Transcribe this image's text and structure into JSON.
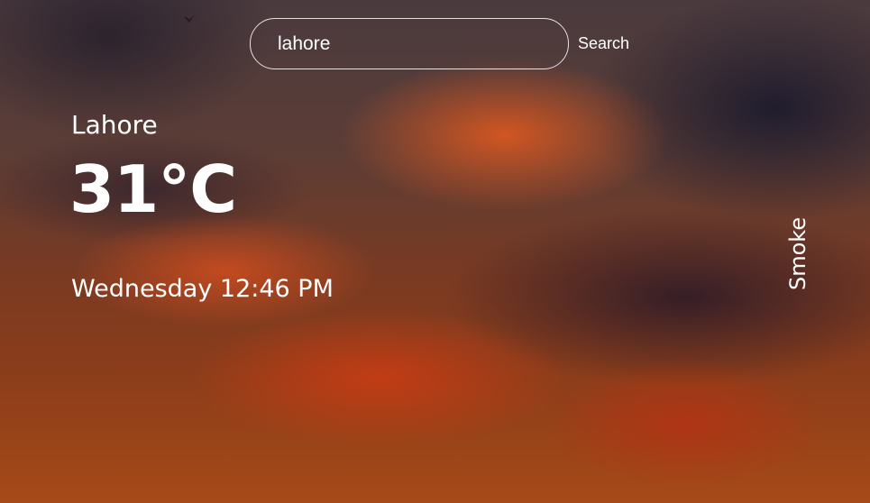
{
  "search": {
    "value": "lahore",
    "button_label": "Search"
  },
  "weather": {
    "city": "Lahore",
    "temperature": "31°C",
    "datetime": "Wednesday 12:46 PM",
    "condition": "Smoke"
  },
  "background": {
    "description_icon": "sunset-clouds-image",
    "bird_icon": "bird-icon"
  }
}
